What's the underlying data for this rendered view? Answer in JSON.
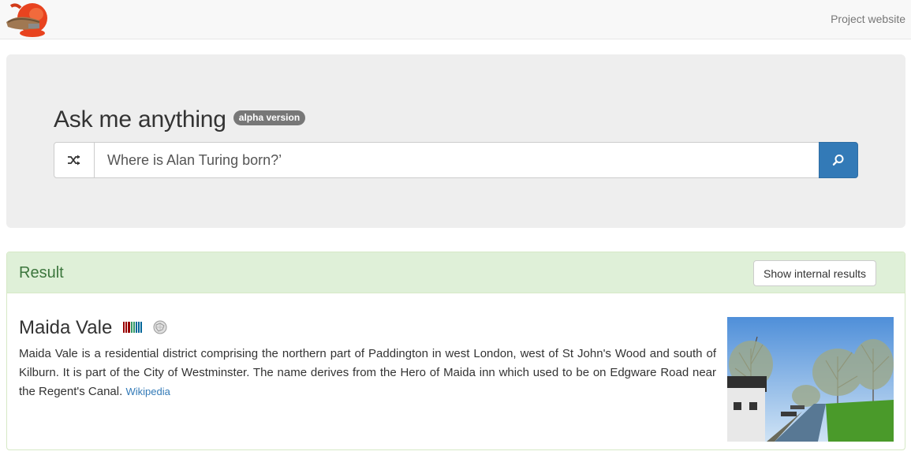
{
  "navbar": {
    "logo_icon": "lobster-logo-icon",
    "project_link": "Project website"
  },
  "jumbotron": {
    "title": "Ask me anything",
    "badge": "alpha version",
    "shuffle_icon": "shuffle-icon",
    "search_value": "Where is Alan Turing born?’",
    "search_icon": "search-icon",
    "accent_color": "#337ab7"
  },
  "result_panel": {
    "heading": "Result",
    "internal_button": "Show internal results",
    "success_bg": "#dff0d8",
    "success_text": "#3c763d",
    "item": {
      "title": "Maida Vale",
      "wikidata_icon": "wikidata-icon",
      "wikipedia_icon": "wikipedia-icon",
      "description": "Maida Vale is a residential district comprising the northern part of Paddington in west London, west of St John's Wood and south of Kilburn. It is part of the City of Westminster. The name derives from the Hero of Maida inn which used to be on Edgware Road near the Regent's Canal.",
      "source_link": "Wikipedia",
      "image_icon": "canal-photo"
    }
  }
}
